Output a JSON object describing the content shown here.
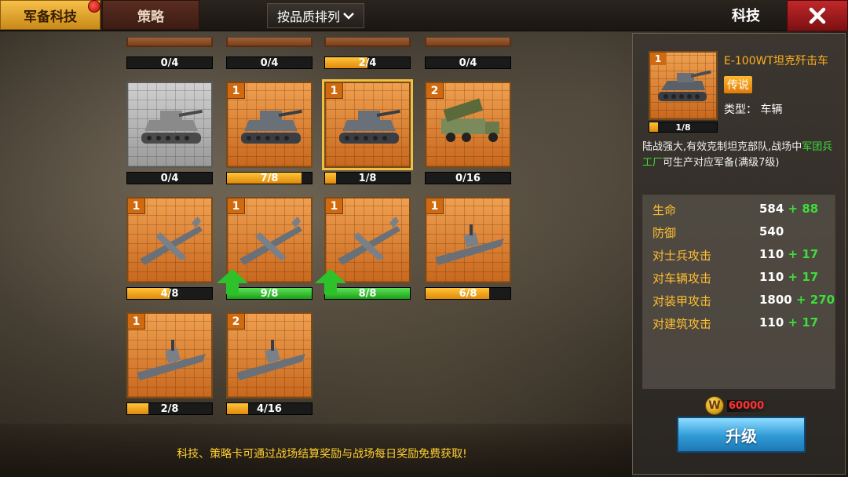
{
  "tabs": [
    {
      "label": "军备科技",
      "active": true,
      "has_notification": true
    },
    {
      "label": "策略",
      "active": false
    }
  ],
  "sort_button": {
    "label": "按品质排列",
    "icon": "chevron-down-icon"
  },
  "panel_title": "科技",
  "close_icon": "close-icon",
  "top_row_progress": [
    {
      "text": "0/4",
      "progress": 0
    },
    {
      "text": "0/4",
      "progress": 0
    },
    {
      "text": "2/4",
      "progress": 0.5
    },
    {
      "text": "0/4",
      "progress": 0
    }
  ],
  "cards": [
    {
      "name": "heavy-tank-grey",
      "level": "",
      "progress_text": "0/4",
      "progress": 0,
      "locked": true,
      "unit": "tank",
      "upgradable": false
    },
    {
      "name": "maus-tank",
      "level": "1",
      "progress_text": "7/8",
      "progress": 0.875,
      "locked": false,
      "unit": "tank",
      "upgradable": false
    },
    {
      "name": "e100-tank-destroyer",
      "level": "1",
      "progress_text": "1/8",
      "progress": 0.125,
      "locked": false,
      "unit": "tank",
      "upgradable": false,
      "selected": true
    },
    {
      "name": "rocket-truck",
      "level": "2",
      "progress_text": "0/16",
      "progress": 0,
      "locked": false,
      "unit": "truck",
      "upgradable": false
    },
    {
      "name": "bomber-1",
      "level": "1",
      "progress_text": "4/8",
      "progress": 0.5,
      "locked": false,
      "unit": "plane",
      "upgradable": false
    },
    {
      "name": "bomber-2",
      "level": "1",
      "progress_text": "9/8",
      "progress": 1,
      "locked": false,
      "unit": "plane",
      "upgradable": true
    },
    {
      "name": "jet-fighter",
      "level": "1",
      "progress_text": "8/8",
      "progress": 1,
      "locked": false,
      "unit": "plane",
      "upgradable": true
    },
    {
      "name": "battleship",
      "level": "1",
      "progress_text": "6/8",
      "progress": 0.75,
      "locked": false,
      "unit": "ship",
      "upgradable": false
    },
    {
      "name": "destroyer",
      "level": "1",
      "progress_text": "2/8",
      "progress": 0.25,
      "locked": false,
      "unit": "ship",
      "upgradable": false
    },
    {
      "name": "aircraft-carrier",
      "level": "2",
      "progress_text": "4/16",
      "progress": 0.25,
      "locked": false,
      "unit": "ship",
      "upgradable": false
    }
  ],
  "tip": "科技、策略卡可通过战场结算奖励与战场每日奖励免费获取!",
  "detail": {
    "level": "1",
    "progress_text": "1/8",
    "progress": 0.125,
    "name": "E-100WT坦克歼击车",
    "rarity": "传说",
    "type": "类型：  车辆",
    "desc_1": "陆战强大,有效克制坦克部队,战场中",
    "desc_highlight": "军团兵工厂",
    "desc_2": "可生产对应军备(满级7级)",
    "stats": [
      {
        "label": "生命",
        "value": "584",
        "bonus": "+ 88"
      },
      {
        "label": "防御",
        "value": "540",
        "bonus": ""
      },
      {
        "label": "对士兵攻击",
        "value": "110",
        "bonus": "+ 17"
      },
      {
        "label": "对车辆攻击",
        "value": "110",
        "bonus": "+ 17"
      },
      {
        "label": "对装甲攻击",
        "value": "1800",
        "bonus": "+ 270"
      },
      {
        "label": "对建筑攻击",
        "value": "110",
        "bonus": "+ 17"
      }
    ],
    "cost": "60000",
    "coin_letter": "W",
    "upgrade_label": "升级"
  }
}
